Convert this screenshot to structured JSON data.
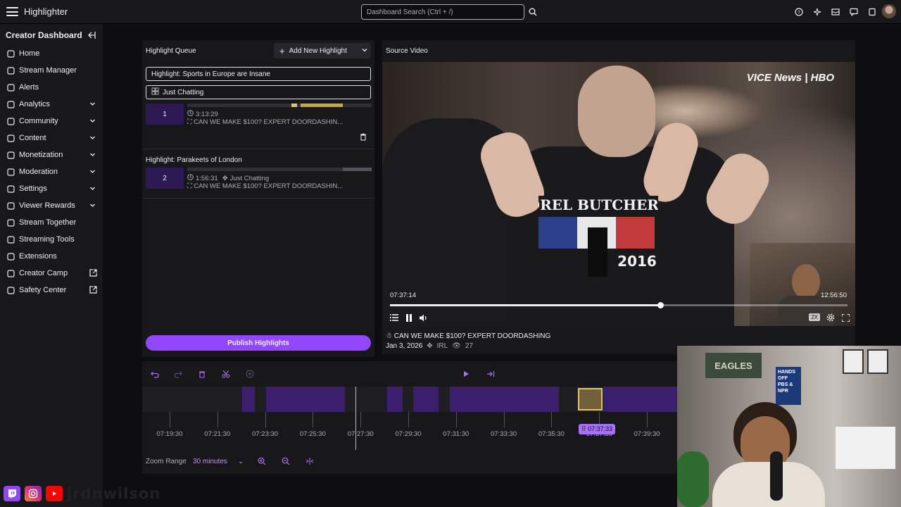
{
  "app": {
    "title": "Highlighter"
  },
  "search": {
    "placeholder": "Dashboard Search (Ctrl + /)"
  },
  "sidebar": {
    "title": "Creator Dashboard",
    "items": [
      {
        "label": "Home",
        "icon": "home-icon"
      },
      {
        "label": "Stream Manager",
        "icon": "stream-manager-icon"
      },
      {
        "label": "Alerts",
        "icon": "alerts-icon"
      },
      {
        "label": "Analytics",
        "icon": "analytics-icon",
        "expandable": true
      },
      {
        "label": "Community",
        "icon": "community-icon",
        "expandable": true
      },
      {
        "label": "Content",
        "icon": "content-icon",
        "expandable": true
      },
      {
        "label": "Monetization",
        "icon": "monetization-icon",
        "expandable": true
      },
      {
        "label": "Moderation",
        "icon": "moderation-icon",
        "expandable": true
      },
      {
        "label": "Settings",
        "icon": "settings-icon",
        "expandable": true
      },
      {
        "label": "Viewer Rewards",
        "icon": "viewer-rewards-icon",
        "expandable": true
      },
      {
        "label": "Stream Together",
        "icon": "stream-together-icon"
      },
      {
        "label": "Streaming Tools",
        "icon": "streaming-tools-icon"
      },
      {
        "label": "Extensions",
        "icon": "extensions-icon"
      },
      {
        "label": "Creator Camp",
        "icon": "creator-camp-icon",
        "external": true
      },
      {
        "label": "Safety Center",
        "icon": "safety-center-icon",
        "external": true
      }
    ]
  },
  "queue": {
    "title": "Highlight Queue",
    "add_label": "Add New Highlight",
    "title_input": "Highlight: Sports in Europe are Insane",
    "category_input": "Just Chatting",
    "items": [
      {
        "number": "1",
        "duration": "3:13:29",
        "category": "",
        "stream_title": "CAN WE MAKE $100? EXPERT DOORDASHIN..."
      },
      {
        "title": "Highlight: Parakeets of London",
        "number": "2",
        "duration": "1:56:31",
        "category": "Just Chatting",
        "stream_title": "CAN WE MAKE $100? EXPERT DOORDASHIN..."
      }
    ],
    "publish_label": "Publish Highlights"
  },
  "video": {
    "title": "Source Video",
    "watermark": "VICE News | HBO",
    "shirt_text_top": "OREL BUTCHERS",
    "shirt_text_year": "2016",
    "time_current": "07:37:14",
    "time_total": "12:56:50",
    "progress": 0.59,
    "speed": "2X",
    "stream_title": "CAN WE MAKE $100? EXPERT DOORDASHING",
    "date": "Jan 3, 2026",
    "category": "IRL",
    "views": "27"
  },
  "timeline": {
    "ticks": [
      "07:19:30",
      "07:21:30",
      "07:23:30",
      "07:25:30",
      "07:27:30",
      "07:29:30",
      "07:31:30",
      "07:33:30",
      "07:35:30",
      "07:37:30",
      "07:39:30"
    ],
    "current": "07:37:33",
    "zoom_label": "Zoom Range",
    "zoom_value": "30 minutes"
  },
  "overlay": {
    "handle": "jrdnwilson",
    "webcam_sign": "HANDS OFF PBS & NPR",
    "webcam_banner": "EAGLES"
  },
  "colors": {
    "accent": "#9147ff",
    "highlight": "#e6c35c"
  }
}
